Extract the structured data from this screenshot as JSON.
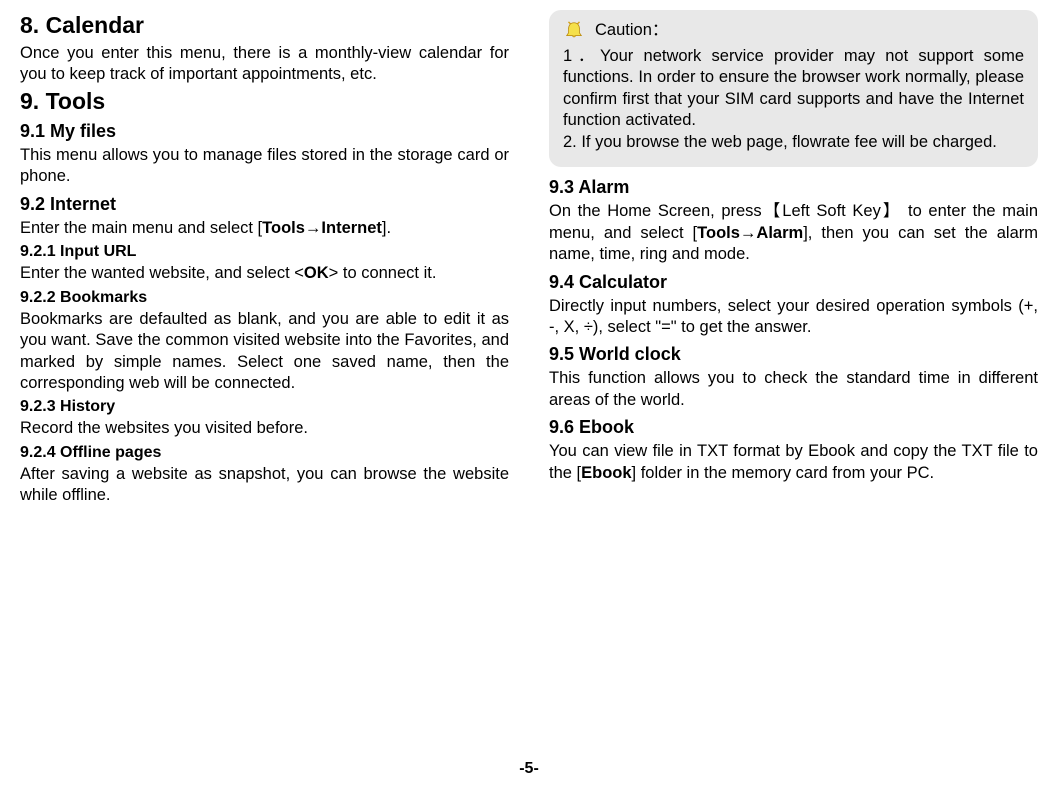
{
  "left": {
    "h_calendar": "8. Calendar",
    "p_calendar": "Once you enter this menu, there is a monthly-view calendar for you to keep track of important appointments, etc.",
    "h_tools": "9. Tools",
    "h_myfiles": "9.1 My files",
    "p_myfiles": "This menu allows you to manage files stored in the storage card or phone.",
    "h_internet": "9.2 Internet",
    "p_internet_pre": "Enter the main menu and select [",
    "p_internet_bold": "Tools→Internet",
    "p_internet_post": "].",
    "h_inputurl": "9.2.1 Input URL",
    "p_inputurl_pre": "Enter the wanted website, and select <",
    "p_inputurl_bold": "OK",
    "p_inputurl_post": "> to connect it.",
    "h_bookmarks": "9.2.2 Bookmarks",
    "p_bookmarks": "Bookmarks are defaulted as blank, and you are able to edit it as you want. Save the common visited website into the Favorites, and marked by simple names. Select one saved name, then the corresponding web will be connected.",
    "h_history": "9.2.3 History",
    "p_history": "Record the websites you visited before.",
    "h_offline": "9.2.4 Offline pages",
    "p_offline": "After saving a website as snapshot, you can browse the website while offline."
  },
  "right": {
    "caution_label": "Caution：",
    "caution1": "1．Your network service provider may not support some functions. In order to ensure the browser work normally, please confirm first that your SIM card supports and have the Internet function activated.",
    "caution2": "2. If you browse the web page, flowrate fee will be charged.",
    "h_alarm": "9.3 Alarm",
    "p_alarm_pre": "On the Home Screen, press【Left Soft Key】 to enter the main menu, and select [",
    "p_alarm_bold": "Tools→Alarm",
    "p_alarm_post": "], then you can set the alarm name, time, ring and mode.",
    "h_calc": "9.4 Calculator",
    "p_calc": "Directly input numbers, select your desired operation symbols (+, -, X, ÷), select \"=\" to get the answer.",
    "h_world": "9.5 World clock",
    "p_world": "This function allows you to check the standard time in different areas of the world.",
    "h_ebook": "9.6 Ebook",
    "p_ebook_pre": "You can view file in TXT format by Ebook and copy the TXT file to the [",
    "p_ebook_bold": "Ebook",
    "p_ebook_post": "] folder in the memory card from your PC."
  },
  "footer": "-5-"
}
